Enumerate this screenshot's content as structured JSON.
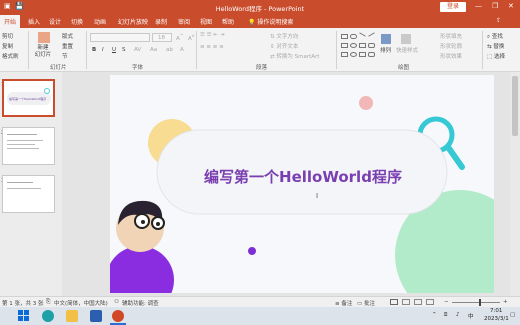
{
  "window": {
    "title": "HelloWord程序 - PowerPoint",
    "login": "登录",
    "minimize": "—",
    "restore": "❐",
    "close": "✕"
  },
  "tabs": [
    {
      "label": "开始"
    },
    {
      "label": "插入"
    },
    {
      "label": "设计"
    },
    {
      "label": "切换"
    },
    {
      "label": "动画"
    },
    {
      "label": "幻灯片放映"
    },
    {
      "label": "录制"
    },
    {
      "label": "审阅"
    },
    {
      "label": "视图"
    },
    {
      "label": "帮助"
    }
  ],
  "tell_me": "操作说明搜索",
  "ribbon": {
    "clipboard": {
      "cut": "剪切",
      "copy": "复制",
      "format_painter": "格式刷"
    },
    "slides": {
      "new_slide": "新建\n幻灯片",
      "layout": "版式",
      "reset": "重置",
      "section": "节",
      "group_label": "幻灯片"
    },
    "font": {
      "size": "18",
      "bold": "B",
      "italic": "I",
      "underline": "U",
      "strike": "S",
      "group_label": "字体"
    },
    "paragraph": {
      "text_direction": "文字方向",
      "align_text": "对齐文本",
      "smartart": "转换为 SmartArt",
      "group_label": "段落"
    },
    "drawing": {
      "arrange": "排列",
      "quick_styles": "快速样式",
      "shape_fill": "形状填充",
      "shape_outline": "形状轮廓",
      "shape_effects": "形状效果",
      "group_label": "绘图"
    },
    "editing": {
      "find": "查找",
      "replace": "替换",
      "select": "选择"
    }
  },
  "thumbnails": {
    "numbers": [
      "1",
      "2",
      "3"
    ],
    "slide1_title": "编写第一个HelloWorld程序"
  },
  "slide": {
    "title": "编写第一个HelloWorld程序"
  },
  "status": {
    "slide_count": "第 1 张，共 3 张",
    "language": "中文(简体，中国大陆)",
    "accessibility": "辅助功能: 调查",
    "notes": "备注",
    "comments": "批注"
  },
  "taskbar": {
    "ime": "中",
    "time": "7:01",
    "date": "2023/3/1"
  },
  "colors": {
    "accent": "#c94c2c",
    "title_purple": "#7a3fb0"
  }
}
